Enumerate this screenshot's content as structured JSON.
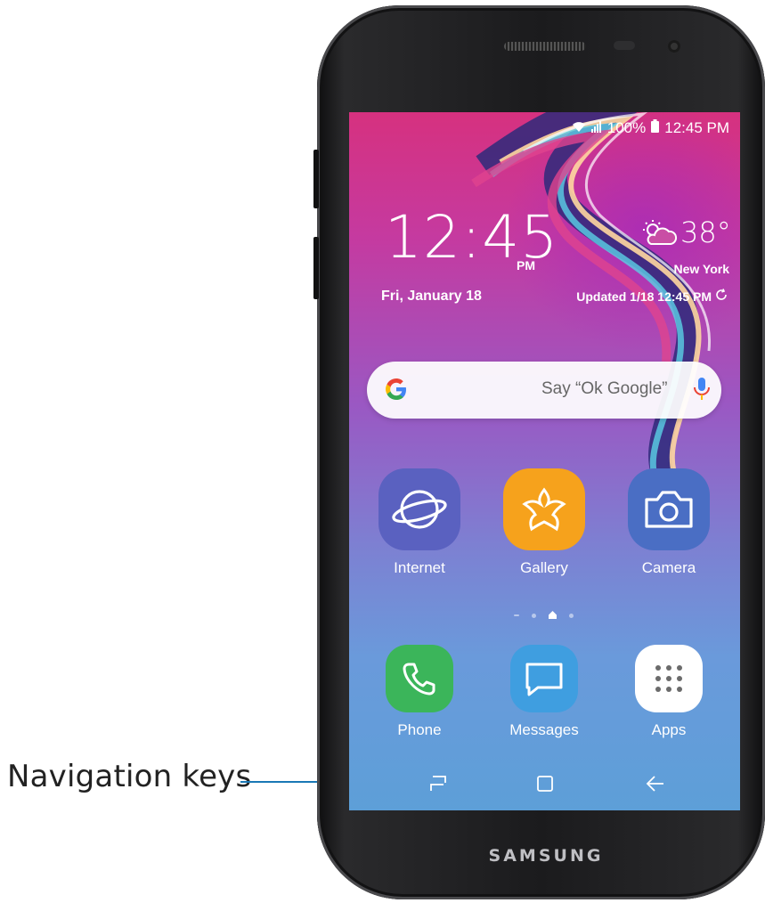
{
  "annotation": {
    "label": "Navigation keys",
    "line_color": "#1a78b5"
  },
  "device": {
    "brand": "SAMSUNG"
  },
  "status_bar": {
    "battery": "100%",
    "time": "12:45 PM",
    "icons": [
      "wifi-icon",
      "signal-icon",
      "battery-icon"
    ]
  },
  "clock_widget": {
    "time": "12:45",
    "ampm": "PM",
    "date": "Fri, January 18",
    "weather_icon": "partly-cloudy-icon",
    "temperature": "38°",
    "city": "New York",
    "updated": "Updated 1/18 12:45 PM",
    "refresh_icon": "refresh-icon"
  },
  "search_bar": {
    "hint": "Say “Ok Google”",
    "icons": [
      "google-g-icon",
      "mic-icon"
    ]
  },
  "apps_row": [
    {
      "label": "Internet",
      "icon": "internet-icon",
      "color": "#5a61c0"
    },
    {
      "label": "Gallery",
      "icon": "gallery-icon",
      "color": "#f6a21c"
    },
    {
      "label": "Camera",
      "icon": "camera-icon",
      "color": "#4a6ec4"
    }
  ],
  "page_indicator": {
    "pages": 4,
    "current": 3,
    "home_page": 3
  },
  "dock": [
    {
      "label": "Phone",
      "icon": "phone-icon",
      "color": "#3bb55a"
    },
    {
      "label": "Messages",
      "icon": "messages-icon",
      "color": "#3f9ee0"
    },
    {
      "label": "Apps",
      "icon": "apps-grid-icon",
      "color": "#ffffff"
    }
  ],
  "navigation_keys": [
    "recents-icon",
    "home-icon",
    "back-icon"
  ]
}
